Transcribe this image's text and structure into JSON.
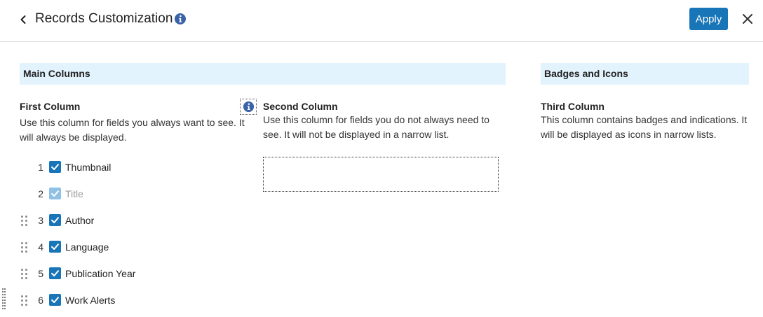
{
  "header": {
    "title": "Records Customization",
    "apply_label": "Apply"
  },
  "sections": {
    "main": "Main Columns",
    "badges": "Badges and Icons"
  },
  "columns": {
    "first": {
      "title": "First Column",
      "desc_line1": "Use this column for fields you always want to see. It",
      "desc_line2": "will always be displayed."
    },
    "second": {
      "title": "Second Column",
      "desc_line1": "Use this column for fields you do not always need to",
      "desc_line2": "see. It will not be displayed in a narrow list."
    },
    "third": {
      "title": "Third Column",
      "desc_line1": "This column contains badges and indications. It",
      "desc_line2": "will be displayed as icons in narrow lists."
    }
  },
  "fields": [
    {
      "num": "1",
      "label": "Thumbnail",
      "checked": true,
      "disabled": false,
      "draggable": false
    },
    {
      "num": "2",
      "label": "Title",
      "checked": true,
      "disabled": true,
      "draggable": false
    },
    {
      "num": "3",
      "label": "Author",
      "checked": true,
      "disabled": false,
      "draggable": true
    },
    {
      "num": "4",
      "label": "Language",
      "checked": true,
      "disabled": false,
      "draggable": true
    },
    {
      "num": "5",
      "label": "Publication Year",
      "checked": true,
      "disabled": false,
      "draggable": true
    },
    {
      "num": "6",
      "label": "Work Alerts",
      "checked": true,
      "disabled": false,
      "draggable": true
    }
  ],
  "colors": {
    "accent": "#1775b8",
    "section_bg": "#e3f3fd",
    "info_icon": "#3a63a8"
  },
  "icons": {
    "back": "chevron-left-icon",
    "info": "info-icon",
    "close": "close-icon",
    "drag": "drag-handle-icon",
    "check": "checkmark-icon"
  }
}
